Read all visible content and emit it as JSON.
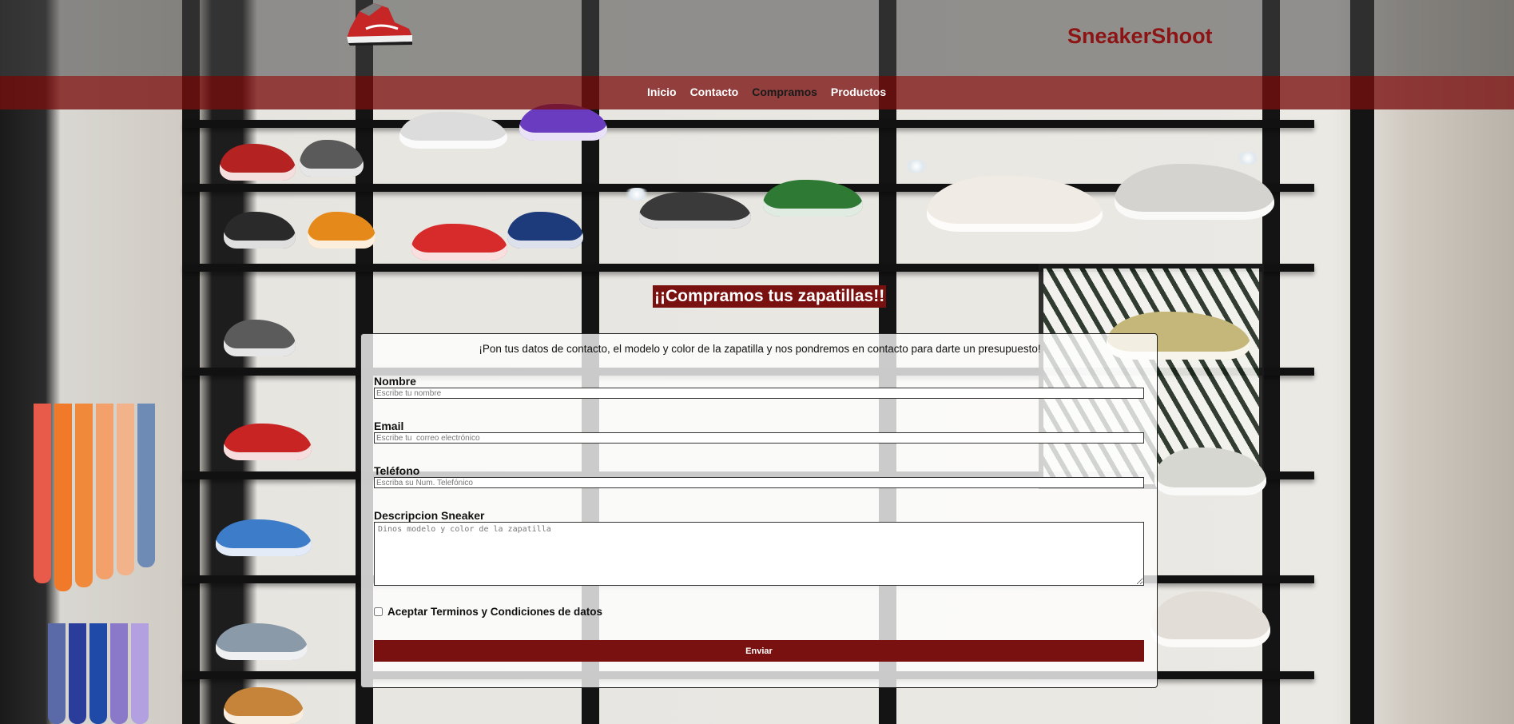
{
  "header": {
    "brand": "SneakerShoot",
    "logo_icon": "sneaker-logo-icon"
  },
  "nav": {
    "items": [
      {
        "label": "Inicio"
      },
      {
        "label": "Contacto"
      },
      {
        "label": "Compramos"
      },
      {
        "label": "Productos"
      }
    ],
    "active": "Compramos"
  },
  "main": {
    "title": "¡¡Compramos tus zapatillas!!"
  },
  "form": {
    "intro": "¡Pon tus datos de contacto, el modelo y color de la zapatilla y nos pondremos en contacto para darte un presupuesto!",
    "name_label": "Nombre",
    "name_placeholder": "Escribe tu nombre",
    "email_label": "Email",
    "email_placeholder": "Escribe tu  correo electrónico",
    "phone_label": "Teléfono",
    "phone_placeholder": "Escriba su Num. Telefónico",
    "description_label": "Descripcion Sneaker",
    "description_placeholder": "Dinos modelo y color de la zapatilla",
    "terms_label": "Aceptar Terminos y Condiciones de datos",
    "terms_checked": false,
    "submit_label": "Enviar"
  },
  "colors": {
    "brand": "#8c1414",
    "navbar": "#7a1111",
    "button": "#7a1111",
    "title_bg": "#7a1111"
  }
}
